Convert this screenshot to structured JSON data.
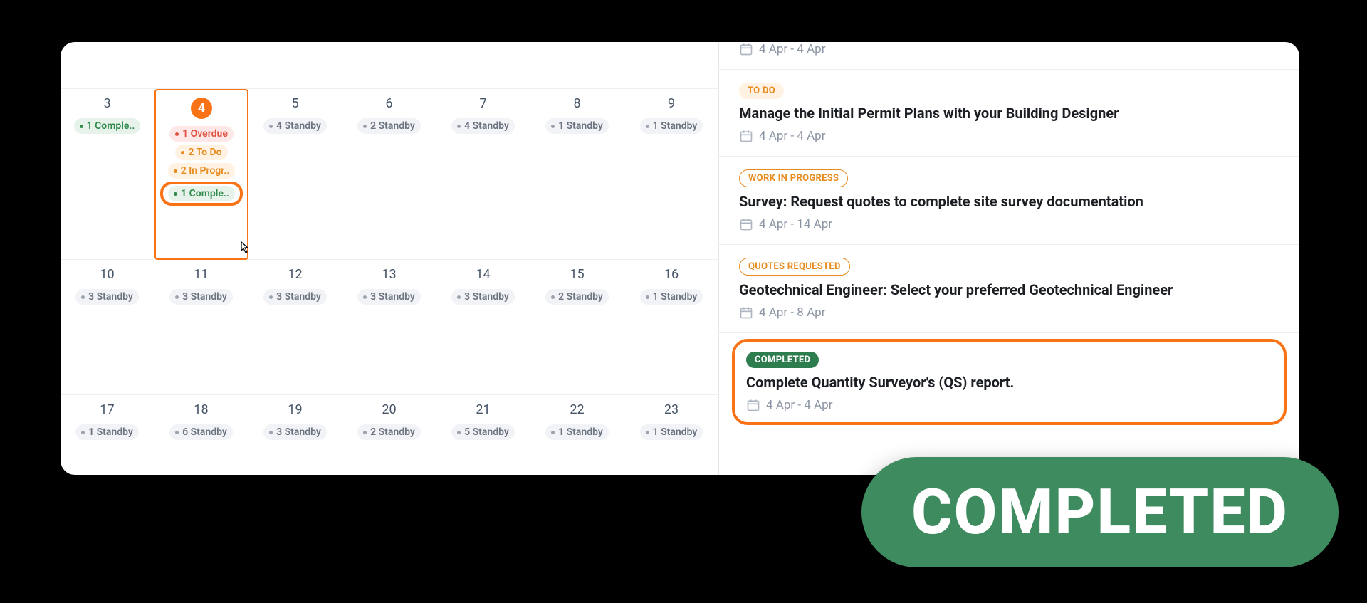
{
  "calendar": {
    "rows": [
      [
        {
          "d": "3",
          "pills": [
            {
              "t": "1 Comple..",
              "k": "completed"
            }
          ]
        },
        {
          "d": "4",
          "selected": true,
          "highlightCompleted": true,
          "pills": [
            {
              "t": "1 Overdue",
              "k": "overdue"
            },
            {
              "t": "2 To Do",
              "k": "todo"
            },
            {
              "t": "2 In Progr..",
              "k": "progress"
            },
            {
              "t": "1 Comple..",
              "k": "completed",
              "hl": true
            }
          ]
        },
        {
          "d": "5",
          "pills": [
            {
              "t": "4 Standby",
              "k": "standby"
            }
          ]
        },
        {
          "d": "6",
          "pills": [
            {
              "t": "2 Standby",
              "k": "standby"
            }
          ]
        },
        {
          "d": "7",
          "pills": [
            {
              "t": "4 Standby",
              "k": "standby"
            }
          ]
        },
        {
          "d": "8",
          "pills": [
            {
              "t": "1 Standby",
              "k": "standby"
            }
          ]
        },
        {
          "d": "9",
          "pills": [
            {
              "t": "1 Standby",
              "k": "standby"
            }
          ]
        }
      ],
      [
        {
          "d": "10",
          "pills": [
            {
              "t": "3 Standby",
              "k": "standby"
            }
          ]
        },
        {
          "d": "11",
          "pills": [
            {
              "t": "3 Standby",
              "k": "standby"
            }
          ]
        },
        {
          "d": "12",
          "pills": [
            {
              "t": "3 Standby",
              "k": "standby"
            }
          ]
        },
        {
          "d": "13",
          "pills": [
            {
              "t": "3 Standby",
              "k": "standby"
            }
          ]
        },
        {
          "d": "14",
          "pills": [
            {
              "t": "3 Standby",
              "k": "standby"
            }
          ]
        },
        {
          "d": "15",
          "pills": [
            {
              "t": "2 Standby",
              "k": "standby"
            }
          ]
        },
        {
          "d": "16",
          "pills": [
            {
              "t": "1 Standby",
              "k": "standby"
            }
          ]
        }
      ],
      [
        {
          "d": "17",
          "pills": [
            {
              "t": "1 Standby",
              "k": "standby"
            }
          ]
        },
        {
          "d": "18",
          "pills": [
            {
              "t": "6 Standby",
              "k": "standby"
            }
          ]
        },
        {
          "d": "19",
          "pills": [
            {
              "t": "3 Standby",
              "k": "standby"
            }
          ]
        },
        {
          "d": "20",
          "pills": [
            {
              "t": "2 Standby",
              "k": "standby"
            }
          ]
        },
        {
          "d": "21",
          "pills": [
            {
              "t": "5 Standby",
              "k": "standby"
            }
          ]
        },
        {
          "d": "22",
          "pills": [
            {
              "t": "1 Standby",
              "k": "standby"
            }
          ]
        },
        {
          "d": "23",
          "pills": [
            {
              "t": "1 Standby",
              "k": "standby"
            }
          ]
        }
      ]
    ]
  },
  "tasks": [
    {
      "status": "",
      "chipClass": "",
      "title": "",
      "dates": "4 Apr - 4 Apr",
      "partialTop": true
    },
    {
      "status": "TO DO",
      "chipClass": "chip-todo",
      "title": "Manage the Initial Permit Plans with your Building Designer",
      "dates": "4 Apr - 4 Apr"
    },
    {
      "status": "WORK IN PROGRESS",
      "chipClass": "chip-wip",
      "title": "Survey: Request quotes to complete site survey documentation",
      "dates": "4 Apr - 14 Apr"
    },
    {
      "status": "QUOTES REQUESTED",
      "chipClass": "chip-quotes",
      "title": "Geotechnical Engineer: Select your preferred Geotechnical Engineer",
      "dates": "4 Apr - 8 Apr"
    },
    {
      "status": "COMPLETED",
      "chipClass": "chip-complete",
      "title": "Complete Quantity Surveyor's (QS) report.",
      "dates": "4 Apr - 4 Apr",
      "highlight": true
    }
  ],
  "bigBadge": "COMPLETED",
  "cursor": "⬚"
}
